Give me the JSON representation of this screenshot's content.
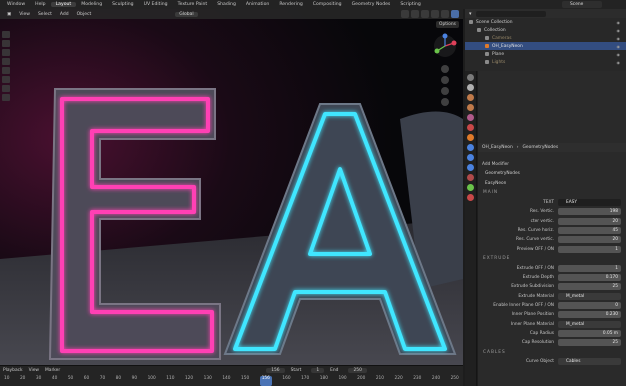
{
  "topbar": {
    "menus": [
      "Window",
      "Help"
    ],
    "workspaces": [
      "Layout",
      "Modeling",
      "Sculpting",
      "UV Editing",
      "Texture Paint",
      "Shading",
      "Animation",
      "Rendering",
      "Compositing",
      "Geometry Nodes",
      "Scripting"
    ],
    "active_workspace": "Layout",
    "scene": "Scene"
  },
  "viewport": {
    "header_items": [
      "View",
      "Select",
      "Add",
      "Object"
    ],
    "transform": "Global",
    "options_label": "Options"
  },
  "timeline": {
    "items": [
      "Playback",
      "View",
      "Marker"
    ],
    "current_frame": "156",
    "start_label": "Start",
    "start": "1",
    "end_label": "End",
    "end": "250",
    "ticks": [
      "10",
      "20",
      "30",
      "40",
      "50",
      "60",
      "70",
      "80",
      "90",
      "100",
      "110",
      "120",
      "130",
      "140",
      "150",
      "156",
      "160",
      "170",
      "180",
      "190",
      "200",
      "210",
      "220",
      "230",
      "240",
      "250"
    ],
    "current_tick": "156"
  },
  "outliner": {
    "rows": [
      {
        "label": "Scene Collection",
        "indent": 0,
        "color": "#d0d0d0",
        "sel": false
      },
      {
        "label": "Collection",
        "indent": 1,
        "color": "#d0d0d0",
        "sel": false
      },
      {
        "label": "Cameras",
        "indent": 2,
        "color": "#9a8a6a",
        "sel": false
      },
      {
        "label": "OH_EasyNeon",
        "indent": 2,
        "color": "#e0e0e0",
        "sel": true
      },
      {
        "label": "Plane",
        "indent": 2,
        "color": "#d0d0d0",
        "sel": false
      },
      {
        "label": "Lights",
        "indent": 2,
        "color": "#9a8a6a",
        "sel": false
      }
    ]
  },
  "properties": {
    "breadcrumb": [
      "OH_EasyNeon",
      "GeometryNodes"
    ],
    "add_modifier": "Add Modifier",
    "modifier_name": "GeometryNodes",
    "nodegroup": "EasyNeon",
    "sections": [
      {
        "title": "MAIN",
        "rows": [
          {
            "label": "TEXT",
            "value": "EASY",
            "kind": "text"
          },
          {
            "label": "Res. Vertic.",
            "value": "198",
            "kind": "num"
          },
          {
            "label": "cter vertic.",
            "value": "20",
            "kind": "num"
          },
          {
            "label": "Res. Curve horiz.",
            "value": "45",
            "kind": "num"
          },
          {
            "label": "Res. Curve vertic.",
            "value": "20",
            "kind": "num"
          },
          {
            "label": "Preview OFF / ON",
            "value": "1",
            "kind": "num"
          }
        ]
      },
      {
        "title": "EXTRUDE",
        "rows": [
          {
            "label": "Extrude OFF / ON",
            "value": "1",
            "kind": "num"
          },
          {
            "label": "Extrude Depth",
            "value": "0.170",
            "kind": "num"
          },
          {
            "label": "Extrude Subdivision",
            "value": "25",
            "kind": "num"
          },
          {
            "label": "Extrude Material",
            "value": "M_metal",
            "kind": "obj"
          },
          {
            "label": "Enable Inner Plane OFF / ON",
            "value": "0",
            "kind": "num"
          },
          {
            "label": "Inner Plane Position",
            "value": "0.230",
            "kind": "num"
          },
          {
            "label": "Inner Plane Material",
            "value": "M_metal",
            "kind": "obj"
          },
          {
            "label": "Cap Radius",
            "value": "0.05 m",
            "kind": "num"
          },
          {
            "label": "Cap Resolution",
            "value": "25",
            "kind": "num"
          }
        ]
      },
      {
        "title": "CABLES",
        "rows": [
          {
            "label": "Curve Object",
            "value": "Cables",
            "kind": "obj"
          }
        ]
      }
    ]
  }
}
